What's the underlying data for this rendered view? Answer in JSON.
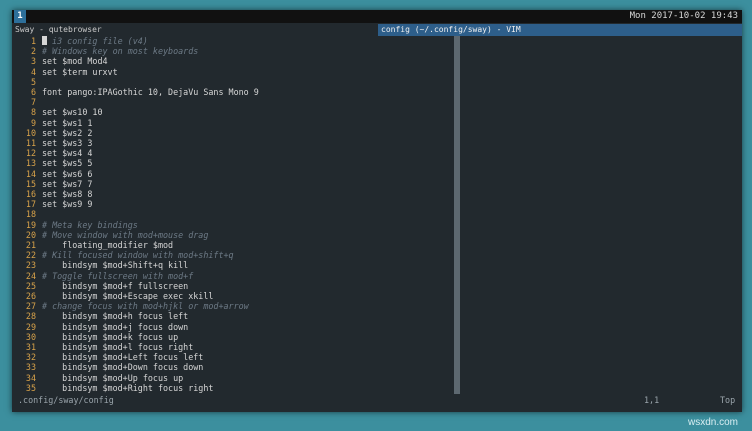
{
  "topbar": {
    "workspace": "1",
    "clock": "Mon 2017-10-02 19:43"
  },
  "windows": {
    "left_title": "Sway - qutebrowser",
    "right_title": "config (~/.config/sway) - VIM"
  },
  "editor": {
    "lines": [
      {
        "n": "1",
        "t": "# i3 config file (v4)",
        "c": true,
        "cursor": true
      },
      {
        "n": "2",
        "t": "# Windows key on most keyboards",
        "c": true
      },
      {
        "n": "3",
        "t": "set $mod Mod4"
      },
      {
        "n": "4",
        "t": "set $term urxvt"
      },
      {
        "n": "5",
        "t": ""
      },
      {
        "n": "6",
        "t": "font pango:IPAGothic 10, DejaVu Sans Mono 9"
      },
      {
        "n": "7",
        "t": ""
      },
      {
        "n": "8",
        "t": "set $ws10 10"
      },
      {
        "n": "9",
        "t": "set $ws1 1"
      },
      {
        "n": "10",
        "t": "set $ws2 2"
      },
      {
        "n": "11",
        "t": "set $ws3 3"
      },
      {
        "n": "12",
        "t": "set $ws4 4"
      },
      {
        "n": "13",
        "t": "set $ws5 5"
      },
      {
        "n": "14",
        "t": "set $ws6 6"
      },
      {
        "n": "15",
        "t": "set $ws7 7"
      },
      {
        "n": "16",
        "t": "set $ws8 8"
      },
      {
        "n": "17",
        "t": "set $ws9 9"
      },
      {
        "n": "18",
        "t": ""
      },
      {
        "n": "19",
        "t": "# Meta key bindings",
        "c": true
      },
      {
        "n": "20",
        "t": "# Move window with mod+mouse drag",
        "c": true
      },
      {
        "n": "21",
        "t": "    floating_modifier $mod"
      },
      {
        "n": "22",
        "t": "# Kill focused window with mod+shift+q",
        "c": true
      },
      {
        "n": "23",
        "t": "    bindsym $mod+Shift+q kill"
      },
      {
        "n": "24",
        "t": "# Toggle fullscreen with mod+f",
        "c": true
      },
      {
        "n": "25",
        "t": "    bindsym $mod+f fullscreen"
      },
      {
        "n": "26",
        "t": "    bindsym $mod+Escape exec xkill"
      },
      {
        "n": "27",
        "t": "# change focus with mod+hjkl or mod+arrow",
        "c": true
      },
      {
        "n": "28",
        "t": "    bindsym $mod+h focus left"
      },
      {
        "n": "29",
        "t": "    bindsym $mod+j focus down"
      },
      {
        "n": "30",
        "t": "    bindsym $mod+k focus up"
      },
      {
        "n": "31",
        "t": "    bindsym $mod+l focus right"
      },
      {
        "n": "32",
        "t": "    bindsym $mod+Left focus left"
      },
      {
        "n": "33",
        "t": "    bindsym $mod+Down focus down"
      },
      {
        "n": "34",
        "t": "    bindsym $mod+Up focus up"
      },
      {
        "n": "35",
        "t": "    bindsym $mod+Right focus right"
      }
    ]
  },
  "statusline": {
    "path": ".config/sway/config",
    "position": "1,1",
    "scroll": "Top"
  },
  "watermark": "wsxdn.com",
  "colors": {
    "background": "#3c8f9e",
    "line_numbers": "#d8a24a",
    "comment": "#6d7a86",
    "focused_title": "#2d5e8a",
    "workspace_active": "#2d6f9a"
  }
}
